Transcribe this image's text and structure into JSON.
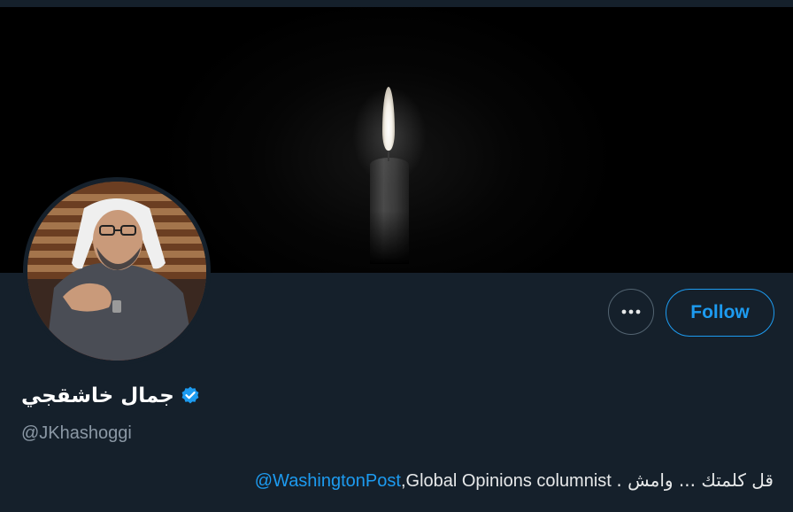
{
  "profile": {
    "display_name": "جمال خاشقجي",
    "handle": "@JKhashoggi",
    "verified": true,
    "bio_mention": "@WashingtonPost",
    "bio_text": " ,Global Opinions columnist . وامش ... قل كلمتك",
    "bio_text_arabic": "قل كلمتك ... وامش .",
    "bio_text_english": ",Global Opinions columnist"
  },
  "actions": {
    "follow_label": "Follow",
    "more_icon": "more-icon"
  },
  "colors": {
    "background": "#15202b",
    "accent": "#1d9bf0",
    "muted": "#8b98a5",
    "banner": "#000000"
  },
  "icons": {
    "verified": "verified-badge-icon"
  }
}
